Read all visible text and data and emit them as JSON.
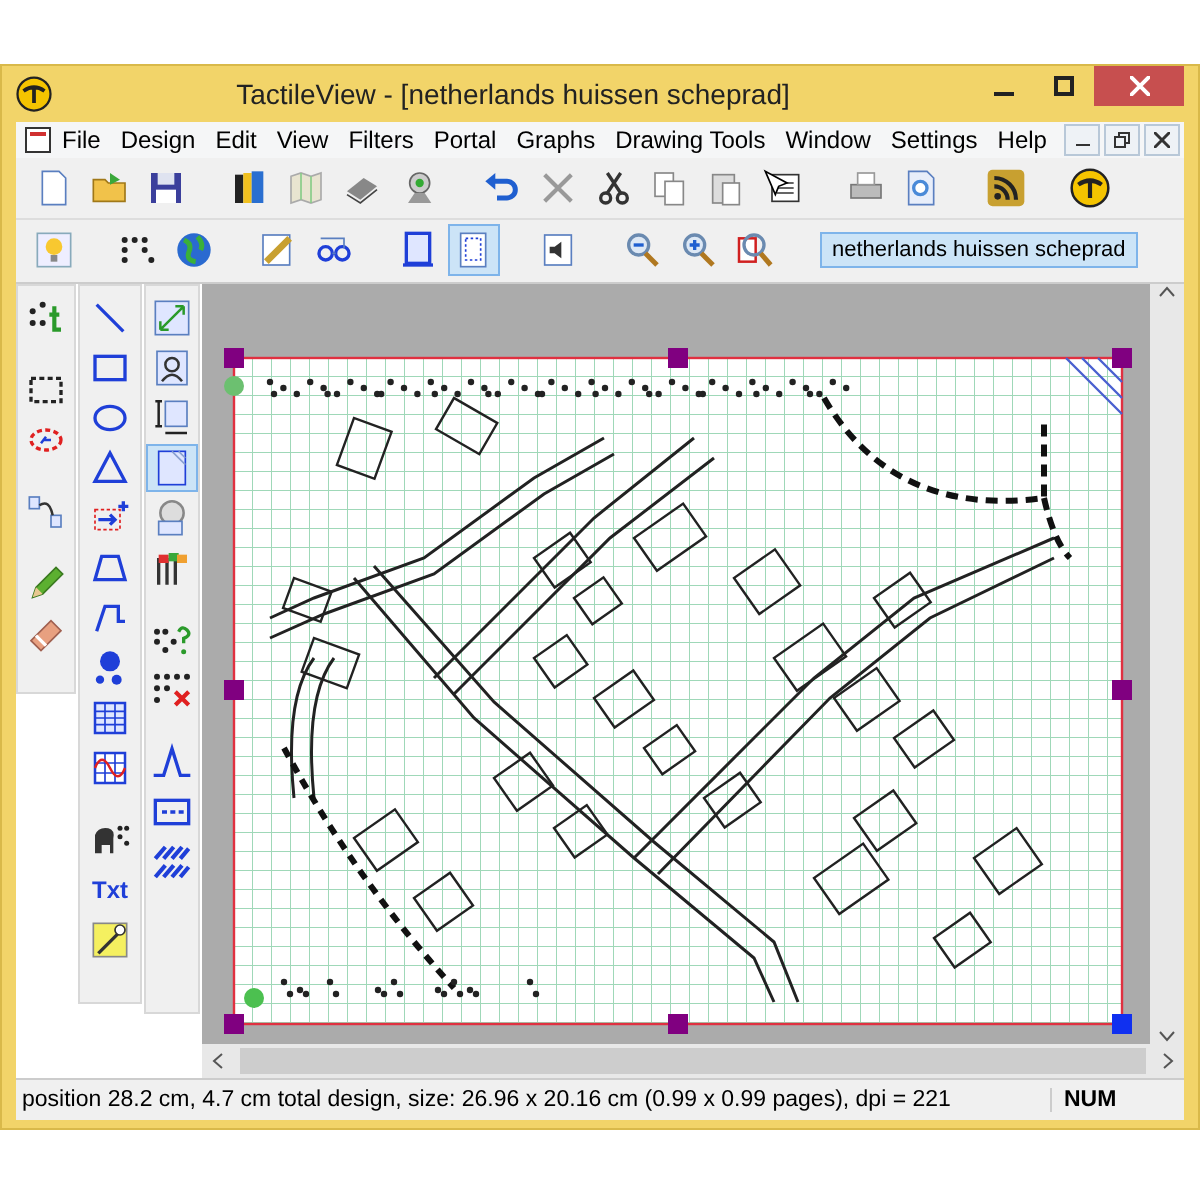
{
  "window": {
    "title": "TactileView - [netherlands huissen scheprad]"
  },
  "menu": [
    "File",
    "Design",
    "Edit",
    "View",
    "Filters",
    "Portal",
    "Graphs",
    "Drawing Tools",
    "Window",
    "Settings",
    "Help"
  ],
  "toolbar_1": [
    {
      "kind": "document",
      "selected": false
    },
    {
      "kind": "folder",
      "selected": false
    },
    {
      "kind": "floppy",
      "selected": false
    },
    {
      "kind": "gap"
    },
    {
      "kind": "books",
      "selected": false
    },
    {
      "kind": "map",
      "selected": false
    },
    {
      "kind": "scanner",
      "selected": false
    },
    {
      "kind": "webcam",
      "selected": false
    },
    {
      "kind": "gap"
    },
    {
      "kind": "undo",
      "selected": false
    },
    {
      "kind": "cross",
      "selected": false
    },
    {
      "kind": "scissors",
      "selected": false
    },
    {
      "kind": "copy",
      "selected": false
    },
    {
      "kind": "paste",
      "selected": false
    },
    {
      "kind": "cursor-list",
      "selected": false
    },
    {
      "kind": "gap"
    },
    {
      "kind": "printer",
      "selected": false
    },
    {
      "kind": "page-magnifier",
      "selected": false
    },
    {
      "kind": "gap"
    },
    {
      "kind": "rss",
      "selected": false
    },
    {
      "kind": "gap"
    },
    {
      "kind": "logo",
      "selected": false
    }
  ],
  "toolbar_2": [
    {
      "kind": "bulb",
      "selected": false
    },
    {
      "kind": "gap"
    },
    {
      "kind": "braille",
      "selected": false
    },
    {
      "kind": "globe",
      "selected": false
    },
    {
      "kind": "gap"
    },
    {
      "kind": "ruler",
      "selected": false
    },
    {
      "kind": "glasses",
      "selected": false
    },
    {
      "kind": "gap"
    },
    {
      "kind": "page-frame",
      "selected": false
    },
    {
      "kind": "page-dotted",
      "selected": true
    },
    {
      "kind": "gap"
    },
    {
      "kind": "speaker",
      "selected": false
    },
    {
      "kind": "gap"
    },
    {
      "kind": "zoom-out",
      "selected": false
    },
    {
      "kind": "zoom-in",
      "selected": false
    },
    {
      "kind": "zoom-page",
      "selected": false
    }
  ],
  "document_tab": {
    "label": "netherlands huissen scheprad",
    "selected": true
  },
  "palette_1": [
    {
      "kind": "braille-t",
      "selected": false
    },
    {
      "kind": "gap"
    },
    {
      "kind": "dotted-rectangle",
      "selected": false
    },
    {
      "kind": "lasso",
      "selected": false
    },
    {
      "kind": "gap"
    },
    {
      "kind": "link-pages",
      "selected": false
    },
    {
      "kind": "gap"
    },
    {
      "kind": "pencil",
      "selected": false
    },
    {
      "kind": "eraser",
      "selected": false
    }
  ],
  "palette_2": [
    {
      "kind": "line",
      "selected": false
    },
    {
      "kind": "rectangle",
      "selected": false
    },
    {
      "kind": "ellipse",
      "selected": false
    },
    {
      "kind": "triangle",
      "selected": false
    },
    {
      "kind": "arrow-box",
      "selected": false
    },
    {
      "kind": "trapezoid",
      "selected": false
    },
    {
      "kind": "polyline",
      "selected": false
    },
    {
      "kind": "dots",
      "selected": false
    },
    {
      "kind": "table",
      "selected": false
    },
    {
      "kind": "graph",
      "selected": false
    },
    {
      "kind": "gap"
    },
    {
      "kind": "elephant",
      "selected": false
    },
    {
      "kind": "text",
      "label": "Txt",
      "selected": false
    },
    {
      "kind": "pen",
      "selected": false
    }
  ],
  "palette_3": [
    {
      "kind": "resize",
      "selected": false
    },
    {
      "kind": "portrait",
      "selected": false
    },
    {
      "kind": "page-size",
      "selected": false
    },
    {
      "kind": "page-hatched",
      "selected": true
    },
    {
      "kind": "magnifier-person",
      "selected": false
    },
    {
      "kind": "flags",
      "selected": false
    },
    {
      "kind": "gap"
    },
    {
      "kind": "braille-question",
      "selected": false
    },
    {
      "kind": "braille-delete",
      "selected": false
    },
    {
      "kind": "gap"
    },
    {
      "kind": "wave-line",
      "selected": false
    },
    {
      "kind": "dashed-box",
      "selected": false
    },
    {
      "kind": "hatch",
      "selected": false
    }
  ],
  "status_bar": {
    "message": "position 28.2 cm, 4.7 cm total design, size: 26.96 x 20.16 cm (0.99 x 0.99 pages), dpi = 221",
    "indicator": "NUM"
  }
}
